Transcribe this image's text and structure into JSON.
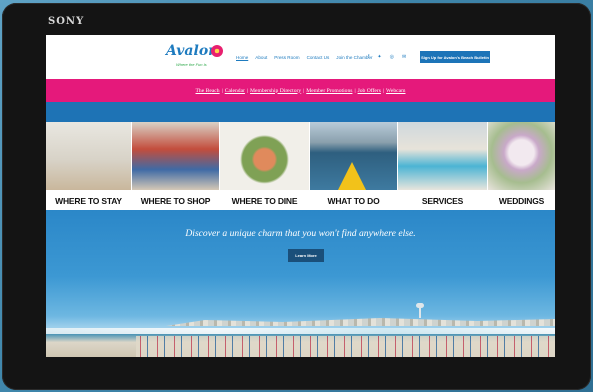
{
  "device": {
    "brand": "SONY"
  },
  "site": {
    "logo": {
      "word": "Avalon",
      "tagline": "Where the Fun Is"
    },
    "nav": [
      {
        "label": "Home"
      },
      {
        "label": "About"
      },
      {
        "label": "Press Room"
      },
      {
        "label": "Contact Us"
      },
      {
        "label": "Join the Chamber"
      }
    ],
    "social": [
      {
        "icon": "facebook-icon",
        "glyph": "f"
      },
      {
        "icon": "twitter-icon",
        "glyph": "✦"
      },
      {
        "icon": "instagram-icon",
        "glyph": "◎"
      },
      {
        "icon": "email-icon",
        "glyph": "✉"
      }
    ],
    "signup_label": "Sign Up for Avalon's Beach Bulletin",
    "quick_links": [
      "The Beach",
      "Calendar",
      "Membership Directory",
      "Member Promotions",
      "Job Offers",
      "Webcam"
    ],
    "tiles": [
      {
        "label": "WHERE TO STAY"
      },
      {
        "label": "WHERE TO SHOP"
      },
      {
        "label": "WHERE TO DINE"
      },
      {
        "label": "WHAT TO DO"
      },
      {
        "label": "SERVICES"
      },
      {
        "label": "WEDDINGS"
      }
    ],
    "hero": {
      "headline": "Discover a unique charm that you won't find anywhere else.",
      "button_label": "Learn More"
    }
  }
}
